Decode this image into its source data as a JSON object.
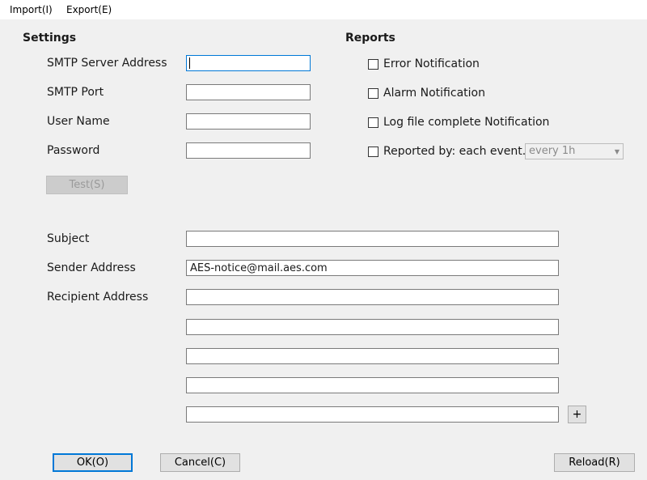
{
  "menu": {
    "import": "Import(I)",
    "export": "Export(E)"
  },
  "settings": {
    "title": "Settings",
    "smtp_server_label": "SMTP Server Address",
    "smtp_server_value": "",
    "smtp_port_label": "SMTP Port",
    "smtp_port_value": "",
    "user_name_label": "User Name",
    "user_name_value": "",
    "password_label": "Password",
    "password_value": "",
    "test_button": "Test(S)"
  },
  "reports": {
    "title": "Reports",
    "error_notification": "Error Notification",
    "alarm_notification": "Alarm Notification",
    "log_complete_notification": "Log file complete Notification",
    "reported_by": "Reported by: each event.",
    "interval_selected": "every 1h"
  },
  "mail": {
    "subject_label": "Subject",
    "subject_value": "",
    "sender_label": "Sender Address",
    "sender_value": "AES-notice@mail.aes.com",
    "recipient_label": "Recipient Address",
    "recipients": [
      "",
      "",
      "",
      "",
      ""
    ],
    "add_recipient_button": "+"
  },
  "footer": {
    "ok_button": "OK(O)",
    "cancel_button": "Cancel(C)",
    "reload_button": "Reload(R)"
  },
  "colors": {
    "focus_accent": "#0078d7",
    "window_bg": "#f0f0f0",
    "menubar_bg": "#ffffff"
  }
}
